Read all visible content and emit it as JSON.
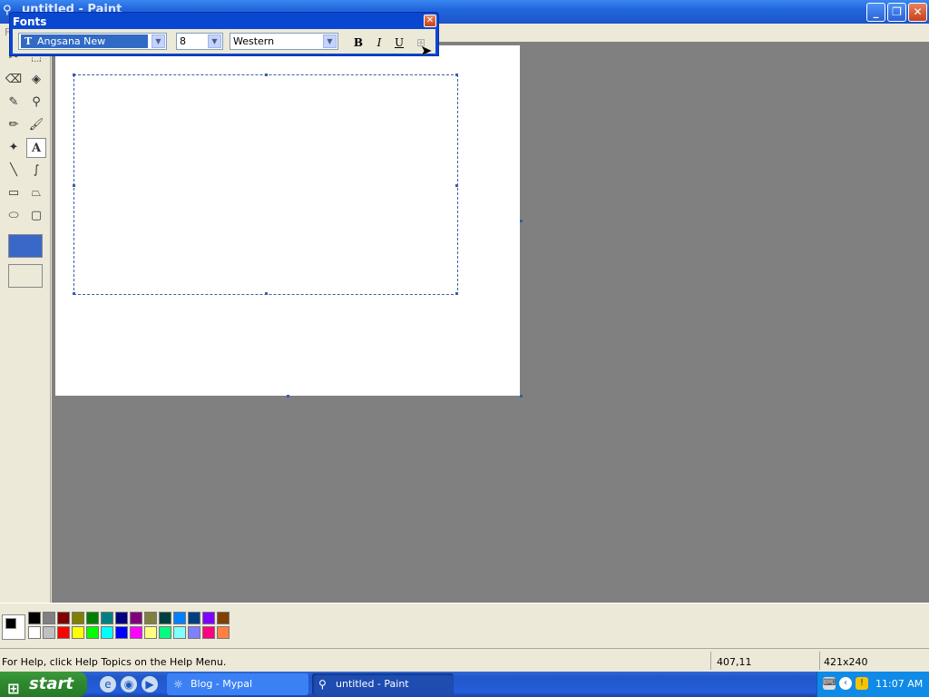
{
  "window": {
    "title": "untitled - Paint",
    "minimize": "_",
    "restore": "❐",
    "close": "✕"
  },
  "menu": [
    "F"
  ],
  "fonts_toolbar": {
    "title": "Fonts",
    "font_name": "Angsana New",
    "font_size": "8",
    "script": "Western",
    "bold": "B",
    "italic": "I",
    "underline": "U",
    "close": "✕"
  },
  "status": {
    "help": "For Help, click Help Topics on the Help Menu.",
    "coords": "407,11",
    "size": "421x240"
  },
  "palette": {
    "foreground": "#000000",
    "background": "#ffffff",
    "row1": [
      "#000000",
      "#808080",
      "#800000",
      "#808000",
      "#008000",
      "#008080",
      "#000080",
      "#800080",
      "#808040",
      "#004040",
      "#0080ff",
      "#004080",
      "#8000ff",
      "#804000"
    ],
    "row2": [
      "#ffffff",
      "#c0c0c0",
      "#ff0000",
      "#ffff00",
      "#00ff00",
      "#00ffff",
      "#0000ff",
      "#ff00ff",
      "#ffff80",
      "#00ff80",
      "#80ffff",
      "#8080ff",
      "#ff0080",
      "#ff8040"
    ]
  },
  "taskbar": {
    "start": "start",
    "tasks": [
      {
        "label": "Blog - Mypal",
        "active": false
      },
      {
        "label": "untitled - Paint",
        "active": true
      }
    ],
    "clock": "11:07 AM"
  }
}
